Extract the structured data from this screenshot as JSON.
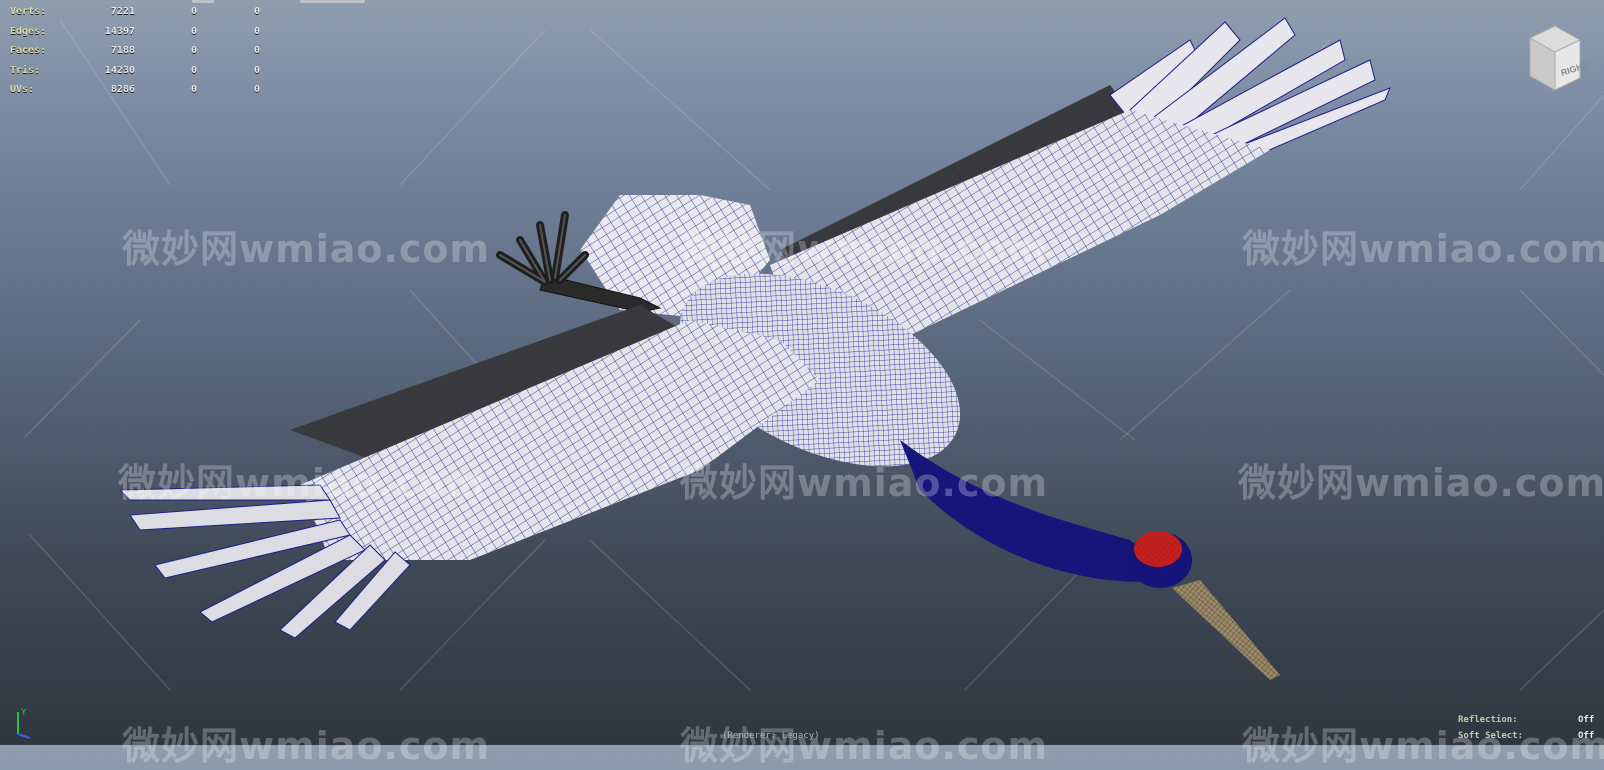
{
  "hud_stats": {
    "rows": [
      {
        "label": "Verts:",
        "v1": "7221",
        "v2": "0",
        "v3": "0"
      },
      {
        "label": "Edges:",
        "v1": "14397",
        "v2": "0",
        "v3": "0"
      },
      {
        "label": "Faces:",
        "v1": "7188",
        "v2": "0",
        "v3": "0"
      },
      {
        "label": "Tris:",
        "v1": "14230",
        "v2": "0",
        "v3": "0"
      },
      {
        "label": "UVs:",
        "v1": "8286",
        "v2": "0",
        "v3": "0"
      }
    ]
  },
  "viewcube": {
    "face_label": "RIGHT"
  },
  "axis_indicator": {
    "x_label": "",
    "y_label": "Y",
    "z_label": ""
  },
  "bottom_right_hud": {
    "rows": [
      {
        "key": "Reflection:",
        "value": "Off"
      },
      {
        "key": "Soft Select:",
        "value": "Off"
      }
    ]
  },
  "bottom_caption": {
    "text": "(Renderer: Legacy)"
  },
  "watermarks": [
    {
      "text": "微妙网wmiao.com"
    },
    {
      "text": "微妙网wmiao.com"
    },
    {
      "text": "微妙网wmiao.com"
    },
    {
      "text": "微妙网wmiao.com"
    },
    {
      "text": "微妙网wmiao.com"
    },
    {
      "text": "微妙网wmiao.com"
    },
    {
      "text": "微妙网wmiao.com"
    },
    {
      "text": "微妙网wmiao.com"
    },
    {
      "text": "微妙网wmiao.com"
    }
  ],
  "colors": {
    "wireframe": "#1e1e8c",
    "feather_light": "#e8e8ee",
    "feather_dark": "#3a3a3a",
    "crown": "#c81e1e",
    "beak": "#9a8a6a"
  },
  "scene_object": "red-crowned crane model in flight (wireframe on shaded)"
}
